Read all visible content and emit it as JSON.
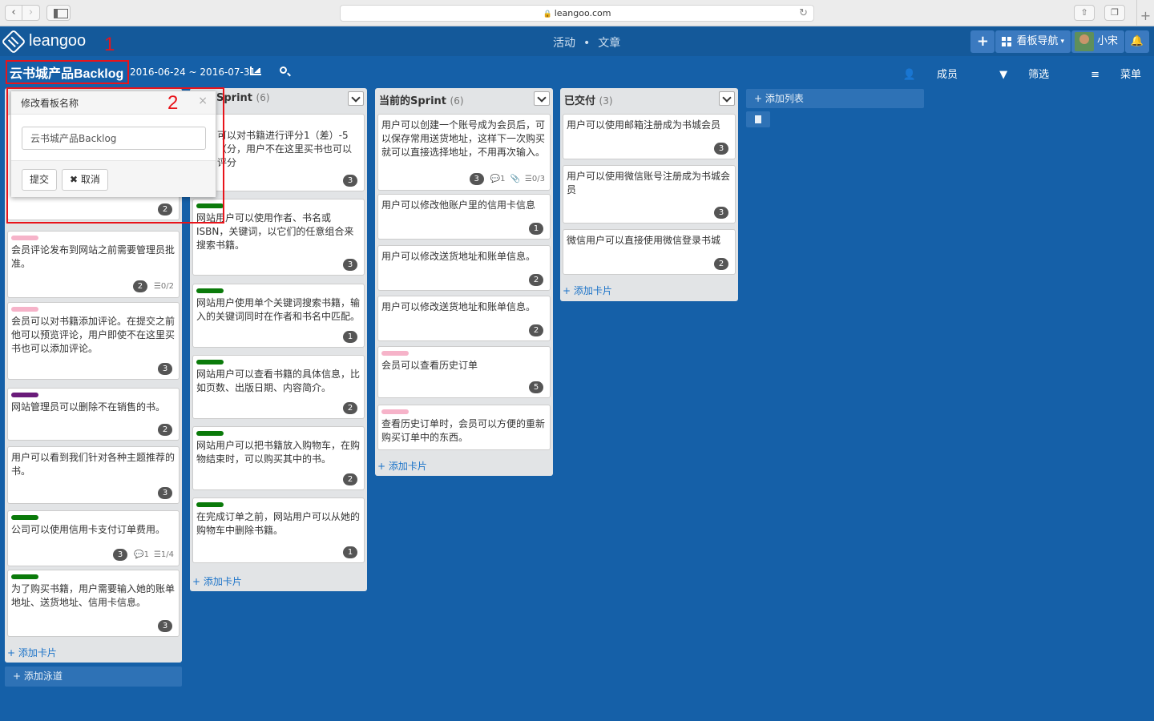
{
  "browser": {
    "url": "leangoo.com",
    "back": "‹",
    "forward": "›"
  },
  "app": {
    "logo": "leangoo",
    "nav": [
      "活动",
      "文章"
    ],
    "nav_sep": "•",
    "add_btn": "+",
    "board_nav": "看板导航",
    "user": "小宋"
  },
  "board": {
    "title": "云书城产品Backlog",
    "dates": "2016-06-24 ~ 2016-07-31",
    "members": "成员",
    "filter": "筛选",
    "menu": "菜单"
  },
  "annotations": [
    "1",
    "2"
  ],
  "popover": {
    "title": "修改看板名称",
    "close": "×",
    "input_value": "云书城产品Backlog",
    "submit": "提交",
    "cancel": "取消",
    "cancel_icon": "✖"
  },
  "colors": {
    "green": "#0a7a0a",
    "pink": "#f6b3c9",
    "purple": "#6a1b7a",
    "page_bg": "#1560a8",
    "header_bg": "#14599a"
  },
  "lists": [
    {
      "name": "",
      "count": "",
      "cards": [
        {
          "text": "",
          "labels": [],
          "points": "2",
          "meta": []
        },
        {
          "text": "会员评论发布到网站之前需要管理员批准。",
          "labels": [
            "pink"
          ],
          "points": "2",
          "meta": [
            "0/2"
          ]
        },
        {
          "text": "会员可以对书籍添加评论。在提交之前他可以预览评论，用户即使不在这里买书也可以添加评论。",
          "labels": [
            "pink"
          ],
          "points": "3",
          "meta": []
        },
        {
          "text": "网站管理员可以删除不在销售的书。",
          "labels": [
            "purple"
          ],
          "points": "2",
          "meta": []
        },
        {
          "text": "用户可以看到我们针对各种主题推荐的书。",
          "labels": [],
          "points": "3",
          "meta": []
        },
        {
          "text": "公司可以使用信用卡支付订单费用。",
          "labels": [
            "green"
          ],
          "points": "3",
          "meta": [
            "1",
            "1/4"
          ]
        },
        {
          "text": "为了购买书籍，用户需要输入她的账单地址、送货地址、信用卡信息。",
          "labels": [
            "green"
          ],
          "points": "3",
          "meta": []
        }
      ],
      "add_card": "添加卡片"
    },
    {
      "name": "Sprint",
      "count": "(6)",
      "cards": [
        {
          "text": "可以对书籍进行评分1（差）-5（分，用户不在这里买书也可以评分",
          "labels": [],
          "points": "3",
          "meta": []
        },
        {
          "text": "网站用户可以使用作者、书名或ISBN，关键词，以它们的任意组合来搜索书籍。",
          "labels": [
            "green"
          ],
          "points": "3",
          "meta": []
        },
        {
          "text": "网站用户使用单个关键词搜索书籍，输入的关键词同时在作者和书名中匹配。",
          "labels": [
            "green"
          ],
          "points": "1",
          "meta": []
        },
        {
          "text": "网站用户可以查看书籍的具体信息，比如页数、出版日期、内容简介。",
          "labels": [
            "green"
          ],
          "points": "2",
          "meta": []
        },
        {
          "text": "网站用户可以把书籍放入购物车，在购物结束时，可以购买其中的书。",
          "labels": [
            "green"
          ],
          "points": "2",
          "meta": []
        },
        {
          "text": "在完成订单之前，网站用户可以从她的购物车中删除书籍。",
          "labels": [
            "green"
          ],
          "points": "1",
          "meta": []
        }
      ],
      "add_card": "添加卡片"
    },
    {
      "name": "当前的Sprint",
      "count": "(6)",
      "cards": [
        {
          "text": "用户可以创建一个账号成为会员后，可以保存常用送货地址，这样下一次购买就可以直接选择地址，不用再次输入。",
          "labels": [],
          "points": "3",
          "meta": [
            "1",
            "0/3"
          ]
        },
        {
          "text": "用户可以修改他账户里的信用卡信息",
          "labels": [],
          "points": "1",
          "meta": []
        },
        {
          "text": "用户可以修改送货地址和账单信息。",
          "labels": [],
          "points": "2",
          "meta": []
        },
        {
          "text": "用户可以修改送货地址和账单信息。",
          "labels": [],
          "points": "2",
          "meta": []
        },
        {
          "text": "会员可以查看历史订单",
          "labels": [
            "pink"
          ],
          "points": "5",
          "meta": []
        },
        {
          "text": "查看历史订单时，会员可以方便的重新购买订单中的东西。",
          "labels": [
            "pink"
          ],
          "points": "",
          "meta": []
        }
      ],
      "add_card": "添加卡片"
    },
    {
      "name": "已交付",
      "count": "(3)",
      "cards": [
        {
          "text": "用户可以使用邮箱注册成为书城会员",
          "labels": [],
          "points": "3",
          "meta": []
        },
        {
          "text": "用户可以使用微信账号注册成为书城会员",
          "labels": [],
          "points": "3",
          "meta": []
        },
        {
          "text": "微信用户可以直接使用微信登录书城",
          "labels": [],
          "points": "2",
          "meta": []
        }
      ],
      "add_card": "添加卡片"
    }
  ],
  "add_list": "添加列表",
  "add_lane": "添加泳道"
}
